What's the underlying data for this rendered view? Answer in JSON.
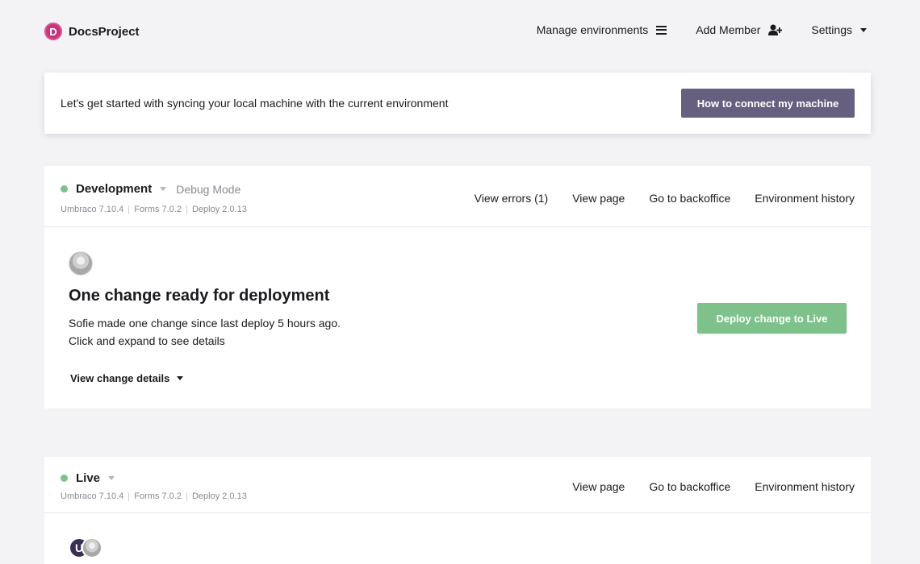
{
  "header": {
    "logo_letter": "D",
    "project_name": "DocsProject",
    "nav": {
      "manage_environments": "Manage environments",
      "add_member": "Add Member",
      "settings": "Settings"
    }
  },
  "banner": {
    "text": "Let's get started with syncing your local machine with the current environment",
    "button_label": "How to connect my machine"
  },
  "environments": [
    {
      "name": "Development",
      "mode": "Debug Mode",
      "status_color": "#7ec18b",
      "versions": [
        "Umbraco 7.10.4",
        "Forms 7.0.2",
        "Deploy 2.0.13"
      ],
      "links": [
        "View errors (1)",
        "View page",
        "Go to backoffice",
        "Environment history"
      ],
      "change": {
        "title": "One change ready for deployment",
        "line1": "Sofie made one change since last deploy 5 hours ago.",
        "line2": "Click and expand to see details",
        "details_label": "View change details",
        "deploy_button": "Deploy change to Live"
      }
    },
    {
      "name": "Live",
      "status_color": "#7ec18b",
      "versions": [
        "Umbraco 7.10.4",
        "Forms 7.0.2",
        "Deploy 2.0.13"
      ],
      "links": [
        "View page",
        "Go to backoffice",
        "Environment history"
      ],
      "avatar_letter": "U"
    }
  ],
  "colors": {
    "background": "#f3f3f5",
    "primary_button": "#665f80",
    "deploy_button": "#7ec18b",
    "brand": "#c2377b"
  }
}
